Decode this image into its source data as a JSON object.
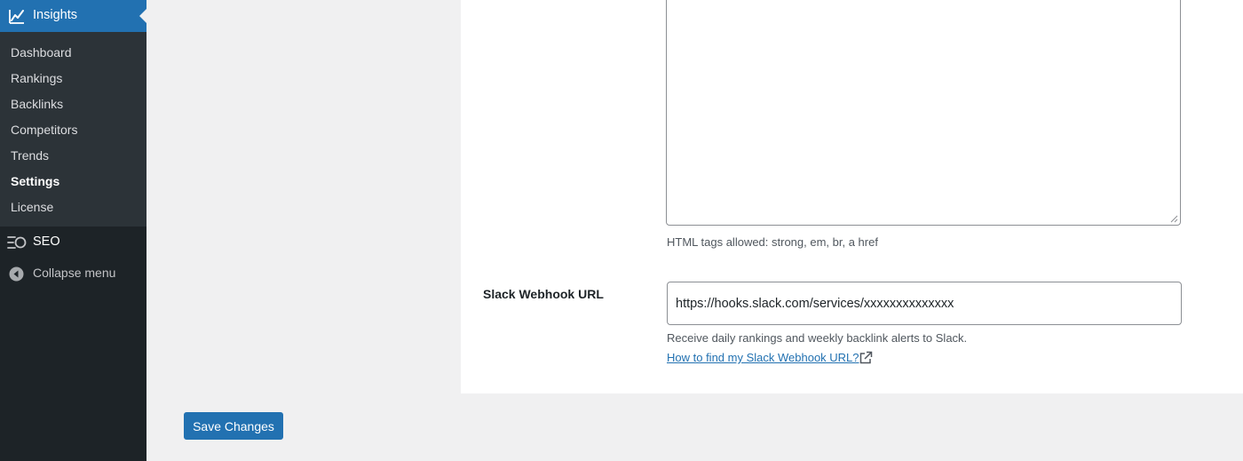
{
  "sidebar": {
    "top_item": {
      "label": "Insights",
      "icon": "chart-line-icon"
    },
    "items": [
      {
        "label": "Dashboard",
        "current": false
      },
      {
        "label": "Rankings",
        "current": false
      },
      {
        "label": "Backlinks",
        "current": false
      },
      {
        "label": "Competitors",
        "current": false
      },
      {
        "label": "Trends",
        "current": false
      },
      {
        "label": "Settings",
        "current": true
      },
      {
        "label": "License",
        "current": false
      }
    ],
    "seo": {
      "label": "SEO",
      "icon": "seo-icon"
    },
    "collapse": {
      "label": "Collapse menu",
      "icon": "collapse-arrow-icon"
    }
  },
  "main": {
    "textarea": {
      "value": "",
      "hint": "HTML tags allowed: strong, em, br, a href"
    },
    "slack": {
      "label": "Slack Webhook URL",
      "value": "https://hooks.slack.com/services/xxxxxxxxxxxxxx",
      "description": "Receive daily rankings and weekly backlink alerts to Slack.",
      "link_text": "How to find my Slack Webhook URL?",
      "link_icon": "external-link-icon"
    },
    "save_label": "Save Changes"
  },
  "colors": {
    "accent": "#2271b1",
    "sidebar_bg": "#1d2327",
    "submenu_bg": "#2c3338",
    "page_bg": "#f0f0f1"
  }
}
